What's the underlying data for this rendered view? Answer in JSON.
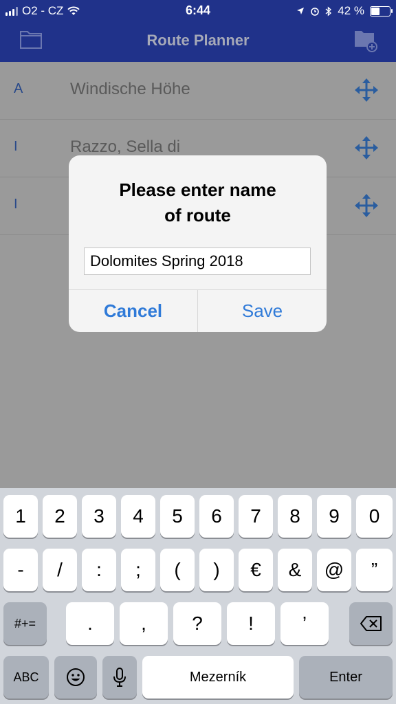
{
  "status_bar": {
    "carrier": "O2 - CZ",
    "time": "6:44",
    "battery": "42 %",
    "battery_level": 0.42
  },
  "nav": {
    "title": "Route Planner",
    "left_icon": "folder-icon",
    "right_icon": "folder-add-icon"
  },
  "routes": [
    {
      "letter": "A",
      "name": "Windische Höhe"
    },
    {
      "letter": "I",
      "name": "Razzo, Sella di"
    },
    {
      "letter": "I",
      "name": ""
    }
  ],
  "dialog": {
    "title_line1": "Please enter name",
    "title_line2": "of route",
    "input_value": "Dolomites Spring 2018",
    "cancel_label": "Cancel",
    "save_label": "Save"
  },
  "keyboard": {
    "row1": [
      "1",
      "2",
      "3",
      "4",
      "5",
      "6",
      "7",
      "8",
      "9",
      "0"
    ],
    "row2": [
      "-",
      "/",
      ":",
      ";",
      "(",
      ")",
      "€",
      "&",
      "@",
      "”"
    ],
    "row3_symbols_label": "#+=",
    "row3": [
      ".",
      ",",
      "?",
      "!",
      "’"
    ],
    "abc_label": "ABC",
    "space_label": "Mezerník",
    "enter_label": "Enter"
  }
}
